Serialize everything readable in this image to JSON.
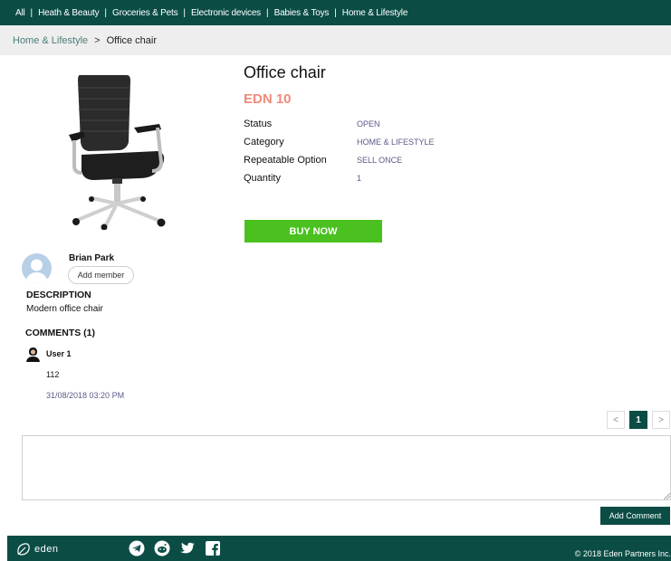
{
  "nav": {
    "items": [
      "All",
      "Heath & Beauty",
      "Groceries & Pets",
      "Electronic devices",
      "Babies & Toys",
      "Home & Lifestyle"
    ],
    "separator": "|"
  },
  "breadcrumb": {
    "parent": "Home & Lifestyle",
    "separator": ">",
    "current": "Office chair"
  },
  "product": {
    "title": "Office chair",
    "price": "EDN 10",
    "fields": [
      {
        "label": "Status",
        "value": "OPEN"
      },
      {
        "label": "Category",
        "value": "HOME & LIFESTYLE"
      },
      {
        "label": "Repeatable Option",
        "value": "SELL ONCE"
      },
      {
        "label": "Quantity",
        "value": "1"
      }
    ],
    "buy_label": "BUY NOW",
    "image_icon": "office-chair-photo"
  },
  "owner": {
    "name": "Brian Park",
    "add_member_label": "Add member",
    "avatar_icon": "user-avatar-placeholder"
  },
  "description": {
    "heading": "DESCRIPTION",
    "text": "Modern office chair"
  },
  "comments": {
    "heading": "COMMENTS (1)",
    "items": [
      {
        "user": "User 1",
        "body": "112",
        "time": "31/08/2018 03:20 PM"
      }
    ],
    "input_value": "",
    "add_label": "Add Comment"
  },
  "pagination": {
    "prev": "<",
    "current": "1",
    "next": ">"
  },
  "footer": {
    "logo_text": "eden",
    "social_icons": [
      "telegram-icon",
      "reddit-icon",
      "twitter-icon",
      "facebook-icon"
    ],
    "copyright": "© 2018 Eden Partners Inc."
  },
  "colors": {
    "brand_dark": "#0b4d45",
    "buy_green": "#4ac11f",
    "price_salmon": "#f08a7a",
    "value_muted": "#5a5a88"
  }
}
